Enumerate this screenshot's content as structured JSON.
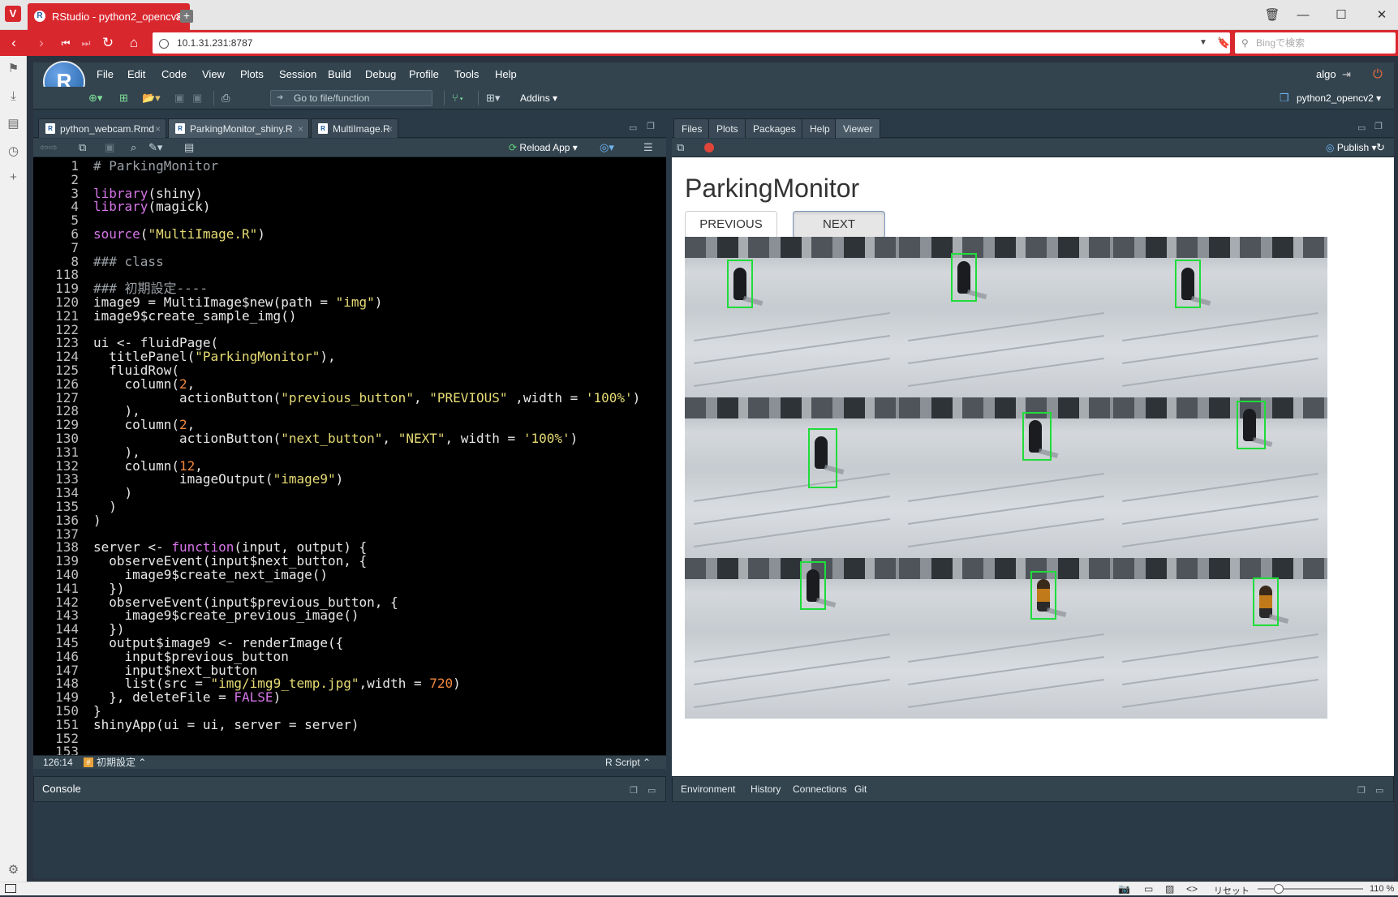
{
  "browser": {
    "tab_title": "RStudio - python2_opencv2",
    "url": "10.1.31.231:8787",
    "search_placeholder": "Bingで検索",
    "zoom": "110 %",
    "reset_label": "リセット"
  },
  "rstudio": {
    "menu": [
      "File",
      "Edit",
      "Code",
      "View",
      "Plots",
      "Session",
      "Build",
      "Debug",
      "Profile",
      "Tools",
      "Help"
    ],
    "user": "algo",
    "project": "python2_opencv2",
    "goto_file": "Go to file/function",
    "addins": "Addins"
  },
  "editor": {
    "tabs": [
      {
        "label": "python_webcam.Rmd",
        "active": false
      },
      {
        "label": "ParkingMonitor_shiny.R",
        "active": true
      },
      {
        "label": "MultiImage.R",
        "active": false
      }
    ],
    "reload_app": "Reload App",
    "cursor_pos": "126:14",
    "section": "初期設定",
    "file_type": "R Script",
    "lines": [
      {
        "n": "1",
        "t": "# ParkingMonitor"
      },
      {
        "n": "2",
        "t": ""
      },
      {
        "n": "3",
        "t": "library(shiny)"
      },
      {
        "n": "4",
        "t": "library(magick)"
      },
      {
        "n": "5",
        "t": ""
      },
      {
        "n": "6",
        "t": "source(\"MultiImage.R\")"
      },
      {
        "n": "7",
        "t": ""
      },
      {
        "n": "8",
        "t": "### class"
      },
      {
        "n": "118",
        "t": ""
      },
      {
        "n": "119",
        "t": "### 初期設定----"
      },
      {
        "n": "120",
        "t": "image9 = MultiImage$new(path = \"img\")"
      },
      {
        "n": "121",
        "t": "image9$create_sample_img()"
      },
      {
        "n": "122",
        "t": ""
      },
      {
        "n": "123",
        "t": "ui <- fluidPage("
      },
      {
        "n": "124",
        "t": "  titlePanel(\"ParkingMonitor\"),"
      },
      {
        "n": "125",
        "t": "  fluidRow("
      },
      {
        "n": "126",
        "t": "    column(2,"
      },
      {
        "n": "127",
        "t": "           actionButton(\"previous_button\", \"PREVIOUS\" ,width = '100%')"
      },
      {
        "n": "128",
        "t": "    ),"
      },
      {
        "n": "129",
        "t": "    column(2,"
      },
      {
        "n": "130",
        "t": "           actionButton(\"next_button\", \"NEXT\", width = '100%')"
      },
      {
        "n": "131",
        "t": "    ),"
      },
      {
        "n": "132",
        "t": "    column(12,"
      },
      {
        "n": "133",
        "t": "           imageOutput(\"image9\")"
      },
      {
        "n": "134",
        "t": "    )"
      },
      {
        "n": "135",
        "t": "  )"
      },
      {
        "n": "136",
        "t": ")"
      },
      {
        "n": "137",
        "t": ""
      },
      {
        "n": "138",
        "t": "server <- function(input, output) {"
      },
      {
        "n": "139",
        "t": "  observeEvent(input$next_button, {"
      },
      {
        "n": "140",
        "t": "    image9$create_next_image()"
      },
      {
        "n": "141",
        "t": "  })"
      },
      {
        "n": "142",
        "t": "  observeEvent(input$previous_button, {"
      },
      {
        "n": "143",
        "t": "    image9$create_previous_image()"
      },
      {
        "n": "144",
        "t": "  })"
      },
      {
        "n": "145",
        "t": "  output$image9 <- renderImage({"
      },
      {
        "n": "146",
        "t": "    input$previous_button"
      },
      {
        "n": "147",
        "t": "    input$next_button"
      },
      {
        "n": "148",
        "t": "    list(src = \"img/img9_temp.jpg\",width = 720)"
      },
      {
        "n": "149",
        "t": "  }, deleteFile = FALSE)"
      },
      {
        "n": "150",
        "t": "}"
      },
      {
        "n": "151",
        "t": "shinyApp(ui = ui, server = server)"
      },
      {
        "n": "152",
        "t": ""
      },
      {
        "n": "153",
        "t": ""
      }
    ]
  },
  "console": {
    "label": "Console"
  },
  "right_pane": {
    "tabs": [
      {
        "label": "Files",
        "active": false
      },
      {
        "label": "Plots",
        "active": false
      },
      {
        "label": "Packages",
        "active": false
      },
      {
        "label": "Help",
        "active": false
      },
      {
        "label": "Viewer",
        "active": true
      }
    ],
    "publish": "Publish",
    "bottom_tabs": [
      "Environment",
      "History",
      "Connections",
      "Git"
    ]
  },
  "app": {
    "title": "ParkingMonitor",
    "previous_label": "PREVIOUS",
    "next_label": "NEXT"
  },
  "colors": {
    "vivaldi_red": "#d9272e",
    "rstudio_bg": "#2b3a47",
    "bbox_green": "#1fdc3a"
  }
}
